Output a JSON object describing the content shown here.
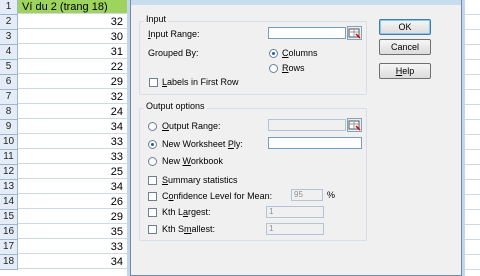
{
  "sheet": {
    "header": {
      "row": "1",
      "value": "Ví du 2 (trang 18)"
    },
    "rows": [
      {
        "row": "2",
        "value": "32"
      },
      {
        "row": "3",
        "value": "30"
      },
      {
        "row": "4",
        "value": "31"
      },
      {
        "row": "5",
        "value": "22"
      },
      {
        "row": "6",
        "value": "29"
      },
      {
        "row": "7",
        "value": "32"
      },
      {
        "row": "8",
        "value": "24"
      },
      {
        "row": "9",
        "value": "34"
      },
      {
        "row": "10",
        "value": "33"
      },
      {
        "row": "11",
        "value": "33"
      },
      {
        "row": "12",
        "value": "25"
      },
      {
        "row": "13",
        "value": "34"
      },
      {
        "row": "14",
        "value": "26"
      },
      {
        "row": "15",
        "value": "29"
      },
      {
        "row": "16",
        "value": "35"
      },
      {
        "row": "17",
        "value": "33"
      },
      {
        "row": "18",
        "value": "34"
      }
    ]
  },
  "dialog": {
    "input_group": "Input",
    "input_range_label": "Input Range:",
    "input_range_value": "",
    "grouped_by_label": "Grouped By:",
    "columns": "Columns",
    "rows": "Rows",
    "labels_first_row": "Labels in First Row",
    "output_group": "Output options",
    "output_range": "Output Range:",
    "new_ply": "New Worksheet Ply:",
    "new_workbook": "New Workbook",
    "summary": "Summary statistics",
    "confidence": "Confidence Level for Mean:",
    "confidence_value": "95",
    "percent": "%",
    "kth_largest": "Kth Largest:",
    "kth_largest_value": "1",
    "kth_smallest": "Kth Smallest:",
    "kth_smallest_value": "1",
    "ok": "OK",
    "cancel": "Cancel",
    "help": "Help"
  }
}
